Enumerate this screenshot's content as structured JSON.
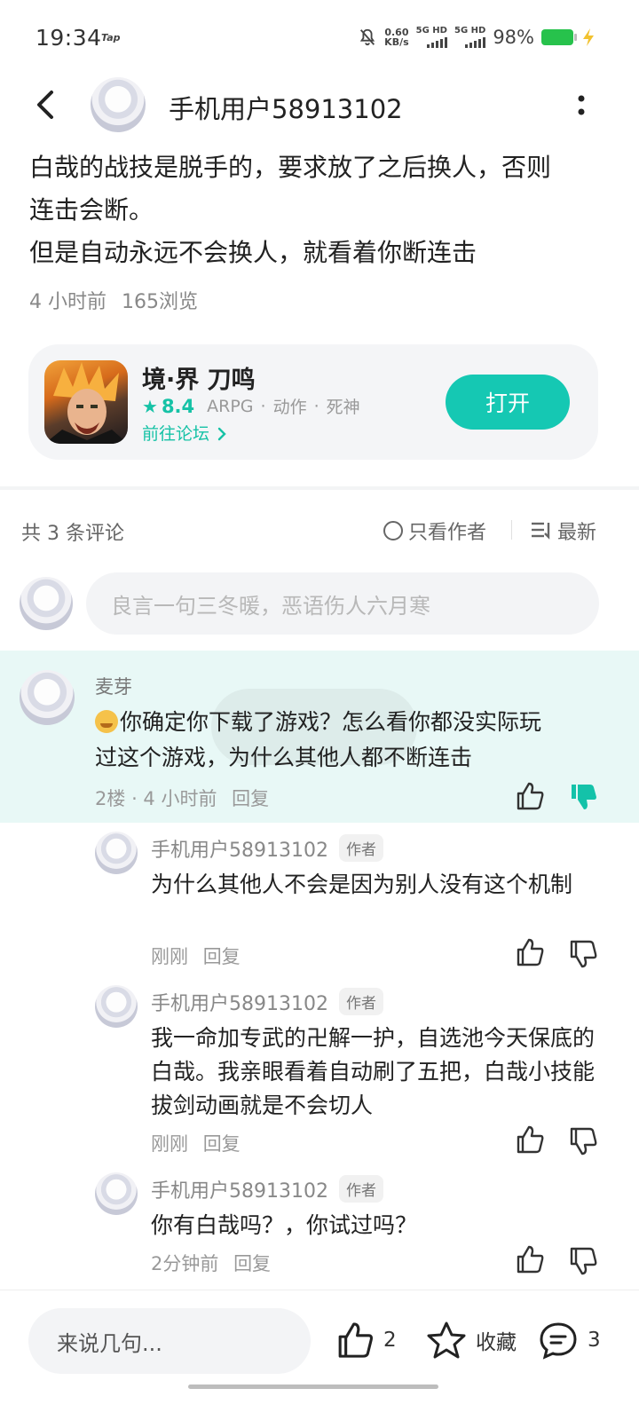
{
  "status_bar": {
    "time": "19:34",
    "tap_badge": "Tap",
    "net_speed_value": "0.60",
    "net_speed_unit": "KB/s",
    "sim1": "5G HD",
    "sim2": "5G HD",
    "battery": "98%",
    "battery_color": "#27c24c"
  },
  "header": {
    "username": "手机用户58913102",
    "back_icon": "chevron-left-icon",
    "more_icon": "more-vertical-icon"
  },
  "post": {
    "text_lines": [
      "白哉的战技是脱手的，要求放了之后换人，否则",
      "连击会断。",
      "但是自动永远不会换人，就看着你断连击"
    ],
    "time": "4 小时前",
    "views": "165浏览"
  },
  "game_card": {
    "title": "境·界 刀鸣",
    "score": "8.4",
    "tags": [
      "ARPG",
      "动作",
      "死神"
    ],
    "forum_link": "前往论坛",
    "open_button": "打开",
    "accent_color": "#15c8b3"
  },
  "comments_header": {
    "count": "共 3 条评论",
    "only_author": "只看作者",
    "sort": "最新"
  },
  "comment_input": {
    "placeholder": "良言一句三冬暖，恶语伤人六月寒"
  },
  "comment": {
    "user": "麦芽",
    "text_line1": "你确定你下载了游戏？怎么看你都没实际玩",
    "text_line2": "过这个游戏，为什么其他人都不断连击",
    "floor": "2楼",
    "time": "4 小时前",
    "reply": "回复",
    "highlight_color": "#e8f8f6",
    "disliked": true
  },
  "replies": [
    {
      "user": "手机用户58913102",
      "tag": "作者",
      "text": "为什么其他人不会是因为别人没有这个机制",
      "time": "刚刚",
      "reply": "回复"
    },
    {
      "user": "手机用户58913102",
      "tag": "作者",
      "text": "我一命加专武的卍解一护，自选池今天保底的白哉。我亲眼看着自动刷了五把，白哉小技能拔剑动画就是不会切人",
      "time": "刚刚",
      "reply": "回复"
    },
    {
      "user": "手机用户58913102",
      "tag": "作者",
      "text": "你有白哉吗？，你试过吗？",
      "time": "2分钟前",
      "reply": "回复"
    }
  ],
  "bottom_bar": {
    "input_placeholder": "来说几句...",
    "like_count": "2",
    "favorite": "收藏",
    "comment_count": "3"
  }
}
